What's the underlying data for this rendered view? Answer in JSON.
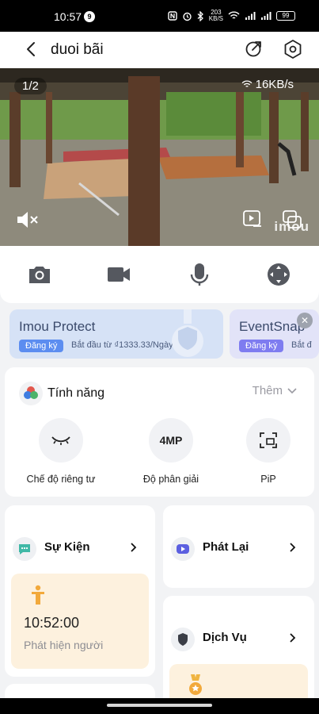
{
  "status_bar": {
    "time": "10:57",
    "notification_count": "9",
    "network_speed": "203",
    "network_speed_unit": "KB/S",
    "battery": "99"
  },
  "nav": {
    "title": "duoi bãi"
  },
  "video": {
    "page_indicator": "1/2",
    "speed": "16KB/s",
    "watermark": "imou"
  },
  "controls": {
    "icons": [
      "camera-icon",
      "video-record-icon",
      "microphone-icon",
      "ptz-direction-icon"
    ]
  },
  "promos": [
    {
      "title": "Imou Protect",
      "tag": "Đăng ký",
      "subtitle": "Bắt đầu từ ₫1333.33/Ngày"
    },
    {
      "title": "EventSnap",
      "tag": "Đăng ký",
      "subtitle": "Bắt đ"
    }
  ],
  "features": {
    "title": "Tính năng",
    "more": "Thêm",
    "items": [
      {
        "label": "Chế độ riêng tư",
        "icon": "eye-closed-icon",
        "text": ""
      },
      {
        "label": "Độ phân giải",
        "icon": "resolution-icon",
        "text": "4MP"
      },
      {
        "label": "PiP",
        "icon": "pip-icon",
        "text": ""
      }
    ]
  },
  "events": {
    "title": "Sự Kiện",
    "latest_time": "10:52:00",
    "latest_label": "Phát hiện người"
  },
  "playback": {
    "title": "Phát Lại"
  },
  "service": {
    "title": "Dịch Vụ"
  },
  "colors": {
    "accent": "#5c8df0",
    "event_bg": "#fdf1de",
    "promo_bg": "#d6e2f6"
  }
}
